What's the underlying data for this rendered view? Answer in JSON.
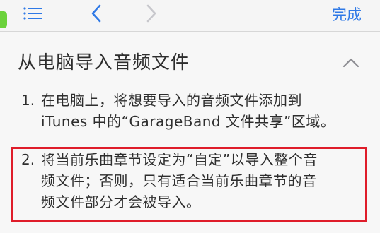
{
  "nav": {
    "done_label": "完成",
    "icons": {
      "list": "list-icon",
      "back": "chevron-left-icon",
      "forward": "chevron-right-icon"
    },
    "accent_color": "#2f79e6"
  },
  "section": {
    "title": "从电脑导入音频文件",
    "collapse_icon": "chevron-up-icon"
  },
  "steps": [
    {
      "number": "1.",
      "lines": [
        "在电脑上，将想要导入的音频文件添加到",
        "iTunes 中的“GarageBand 文件共享”区域。"
      ]
    },
    {
      "number": "2.",
      "lines": [
        "将当前乐曲章节设定为“自定”以导入整个音",
        "频文件；否则，只有适合当前乐曲章节的音",
        "频文件部分才会被导入。"
      ]
    }
  ],
  "highlight": {
    "color": "#df1d2a"
  }
}
